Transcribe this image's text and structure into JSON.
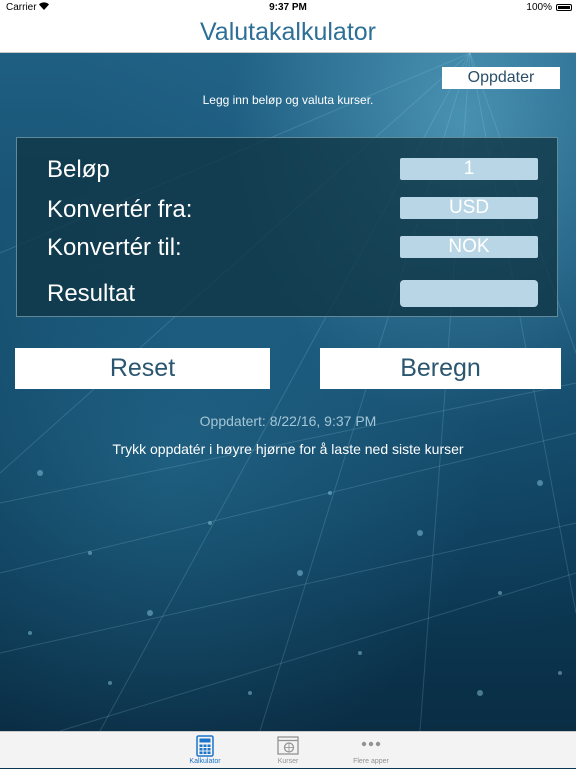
{
  "status_bar": {
    "carrier": "Carrier",
    "time": "9:37 PM",
    "battery": "100%"
  },
  "nav": {
    "title": "Valutakalkulator"
  },
  "toolbar": {
    "update_label": "Oppdater"
  },
  "instruction": "Legg inn beløp og valuta kurser.",
  "form": {
    "amount_label": "Beløp",
    "amount_value": "1",
    "from_label": "Konvertér fra:",
    "from_value": "USD",
    "to_label": "Konvertér til:",
    "to_value": "NOK",
    "result_label": "Resultat",
    "result_value": ""
  },
  "buttons": {
    "reset_label": "Reset",
    "calculate_label": "Beregn"
  },
  "updated_text": "Oppdatert: 8/22/16, 9:37 PM",
  "hint_text": "Trykk oppdatér i høyre hjørne for å laste ned siste kurser",
  "tabs": [
    {
      "label": "Kalkulator",
      "icon": "calculator-icon",
      "active": true
    },
    {
      "label": "Kurser",
      "icon": "rates-icon",
      "active": false
    },
    {
      "label": "Flere apper",
      "icon": "more-icon",
      "active": false
    }
  ],
  "colors": {
    "accent": "#2d6f96",
    "tab_active": "#1a74c9",
    "field_bg": "#b9d6e6"
  }
}
